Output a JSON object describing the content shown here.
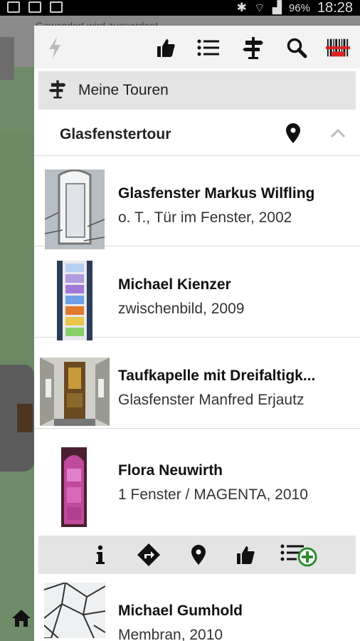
{
  "status_bar": {
    "battery": "96%",
    "time": "18:28"
  },
  "background": {
    "notice": "Gewandert wird zugeordnet"
  },
  "drawer": {
    "section_title": "Meine Touren",
    "tour": {
      "name": "Glasfenstertour"
    },
    "items": [
      {
        "title": "Glasfenster Markus Wilfling",
        "subtitle": "o. T., Tür im Fenster, 2002"
      },
      {
        "title": "Michael Kienzer",
        "subtitle": "zwischenbild, 2009"
      },
      {
        "title": "Taufkapelle mit Dreifaltigk...",
        "subtitle": "Glasfenster Manfred  Erjautz"
      },
      {
        "title": "Flora Neuwirth",
        "subtitle": "1 Fenster / MAGENTA, 2010"
      },
      {
        "title": "Michael Gumhold",
        "subtitle": "Membran, 2010"
      }
    ],
    "icons": {
      "toolbar": [
        "flash-icon",
        "thumbs-up-icon",
        "list-icon",
        "signpost-icon",
        "search-icon",
        "barcode-scan-icon"
      ],
      "actions": [
        "info-icon",
        "directions-icon",
        "map-pin-icon",
        "thumbs-up-icon",
        "add-to-list-icon"
      ]
    },
    "colors": {
      "accent_red": "#e02020",
      "add_green": "#2e8b2e"
    }
  }
}
